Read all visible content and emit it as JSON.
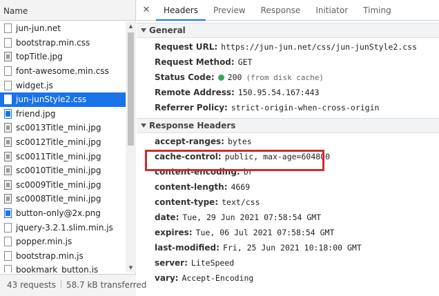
{
  "left_pane": {
    "header": "Name",
    "files": [
      {
        "name": "jun-jun.net",
        "icon": "doc-icon"
      },
      {
        "name": "bootstrap.min.css",
        "icon": "doc-icon"
      },
      {
        "name": "topTitle.jpg",
        "icon": "image-icon"
      },
      {
        "name": "font-awesome.min.css",
        "icon": "doc-icon"
      },
      {
        "name": "widget.js",
        "icon": "doc-icon"
      },
      {
        "name": "jun-junStyle2.css",
        "icon": "doc-icon",
        "selected": true
      },
      {
        "name": "friend.jpg",
        "icon": "image-icon-blue"
      },
      {
        "name": "sc0013Title_mini.jpg",
        "icon": "image-icon"
      },
      {
        "name": "sc0012Title_mini.jpg",
        "icon": "image-icon"
      },
      {
        "name": "sc0011Title_mini.jpg",
        "icon": "image-icon"
      },
      {
        "name": "sc0010Title_mini.jpg",
        "icon": "image-icon"
      },
      {
        "name": "sc0009Title_mini.jpg",
        "icon": "image-icon"
      },
      {
        "name": "sc0008Title_mini.jpg",
        "icon": "image-icon"
      },
      {
        "name": "button-only@2x.png",
        "icon": "image-icon-blue"
      },
      {
        "name": "jquery-3.2.1.slim.min.js",
        "icon": "doc-icon"
      },
      {
        "name": "popper.min.js",
        "icon": "doc-icon"
      },
      {
        "name": "bootstrap.min.js",
        "icon": "doc-icon"
      },
      {
        "name": "bookmark_button.js",
        "icon": "doc-icon"
      }
    ],
    "footer": {
      "requests": "43 requests",
      "transferred": "58.7 kB transferred"
    }
  },
  "tabs": [
    "Headers",
    "Preview",
    "Response",
    "Initiator",
    "Timing"
  ],
  "active_tab": "Headers",
  "general": {
    "title": "General",
    "request_url_key": "Request URL:",
    "request_url": "https://jun-jun.net/css/jun-junStyle2.css",
    "request_method_key": "Request Method:",
    "request_method": "GET",
    "status_code_key": "Status Code:",
    "status_code": "200",
    "status_note": "(from disk cache)",
    "remote_address_key": "Remote Address:",
    "remote_address": "150.95.54.167:443",
    "referrer_policy_key": "Referrer Policy:",
    "referrer_policy": "strict-origin-when-cross-origin"
  },
  "response_headers": {
    "title": "Response Headers",
    "items": [
      {
        "key": "accept-ranges:",
        "value": "bytes"
      },
      {
        "key": "cache-control:",
        "value": "public, max-age=604800"
      },
      {
        "key": "content-encoding:",
        "value": "br"
      },
      {
        "key": "content-length:",
        "value": "4669"
      },
      {
        "key": "content-type:",
        "value": "text/css"
      },
      {
        "key": "date:",
        "value": "Tue, 29 Jun 2021 07:58:54 GMT"
      },
      {
        "key": "expires:",
        "value": "Tue, 06 Jul 2021 07:58:54 GMT"
      },
      {
        "key": "last-modified:",
        "value": "Fri, 25 Jun 2021 10:18:00 GMT"
      },
      {
        "key": "server:",
        "value": "LiteSpeed"
      },
      {
        "key": "vary:",
        "value": "Accept-Encoding"
      }
    ]
  },
  "colors": {
    "accent": "#1a73e8",
    "status_ok": "#34a853",
    "highlight": "#d12b2b"
  }
}
